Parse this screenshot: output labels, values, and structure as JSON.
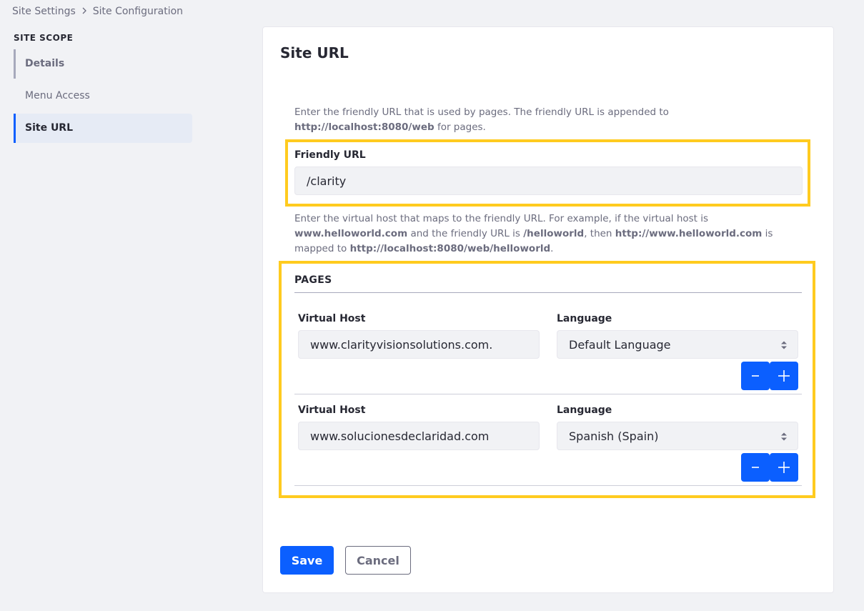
{
  "breadcrumb": {
    "items": [
      "Site Settings",
      "Site Configuration"
    ]
  },
  "sidebar": {
    "heading": "SITE SCOPE",
    "items": [
      {
        "label": "Details"
      },
      {
        "label": "Menu Access"
      },
      {
        "label": "Site URL"
      }
    ]
  },
  "main": {
    "title": "Site URL",
    "friendly_help": {
      "pre": "Enter the friendly URL that is used by pages. The friendly URL is appended to ",
      "url": "http://localhost:8080/web",
      "post": " for pages."
    },
    "friendly_url": {
      "label": "Friendly URL",
      "value": "/clarity"
    },
    "vhost_help": {
      "p1": "Enter the virtual host that maps to the friendly URL. For example, if the virtual host is ",
      "b1": "www.helloworld.com",
      "p2": " and the friendly URL is ",
      "b2": "/helloworld",
      "p3": ", then ",
      "b3": "http://www.helloworld.com",
      "p4": " is mapped to ",
      "b4": "http://localhost:8080/web/helloworld",
      "p5": "."
    },
    "pages": {
      "heading": "PAGES",
      "rows": [
        {
          "host_label": "Virtual Host",
          "host_value": "www.clarityvisionsolutions.com.",
          "lang_label": "Language",
          "lang_value": "Default Language"
        },
        {
          "host_label": "Virtual Host",
          "host_value": "www.solucionesdeclaridad.com",
          "lang_label": "Language",
          "lang_value": "Spanish (Spain)"
        }
      ]
    },
    "actions": {
      "save": "Save",
      "cancel": "Cancel"
    }
  },
  "colors": {
    "primary": "#0b5fff",
    "highlight": "#ffcb1f",
    "background": "#f1f2f5"
  }
}
